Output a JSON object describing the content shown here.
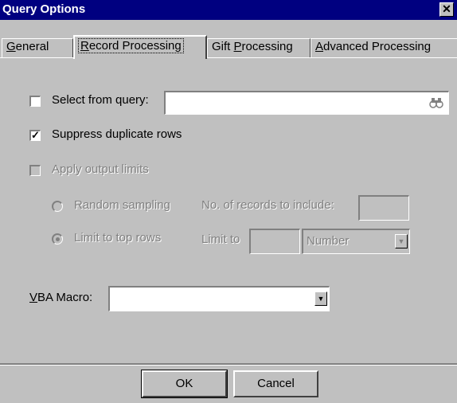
{
  "window": {
    "title": "Query Options",
    "close_glyph": "✕"
  },
  "tabs": [
    {
      "label": "General",
      "mnemonic_index": 0
    },
    {
      "label": "Record Processing",
      "mnemonic_index": 0
    },
    {
      "label": "Gift Processing",
      "mnemonic_index": 5
    },
    {
      "label": "Advanced Processing",
      "mnemonic_index": 0
    }
  ],
  "active_tab": "Record Processing",
  "select_from_query": {
    "label": "Select from query:",
    "checked": false,
    "value": "",
    "lookup_icon": "binoculars-icon"
  },
  "suppress_duplicates": {
    "label": "Suppress duplicate rows",
    "checked": true
  },
  "apply_output_limits": {
    "label": "Apply output limits",
    "checked": false,
    "enabled": false
  },
  "random_sampling": {
    "label": "Random sampling",
    "records_label": "No. of records to include:",
    "value": ""
  },
  "limit_top_rows": {
    "label": "Limit to top rows",
    "limit_label": "Limit to",
    "value": "",
    "unit": "Number",
    "selected": true
  },
  "vba_macro": {
    "label": "VBA Macro:",
    "value": ""
  },
  "buttons": {
    "ok": "OK",
    "cancel": "Cancel"
  }
}
